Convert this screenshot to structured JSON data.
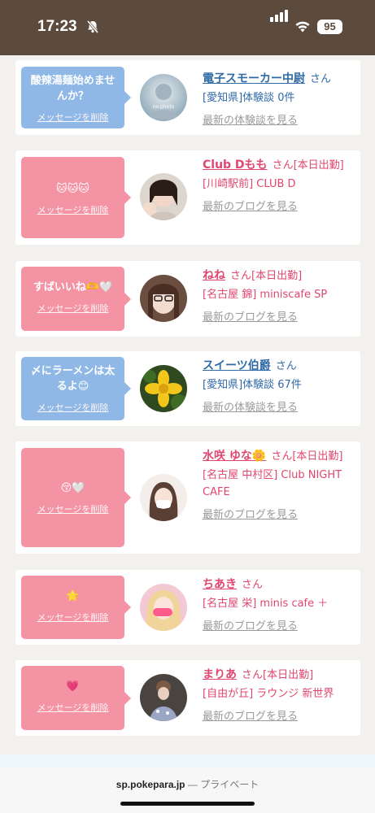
{
  "status": {
    "time": "17:23",
    "battery": "95"
  },
  "browser": {
    "host": "sp.pokepara.jp",
    "separator": "—",
    "mode": "プライベート"
  },
  "items": [
    {
      "color": "blue",
      "message": "酸辣湯麺始めませんか？",
      "delete_label": "メッセージを削除",
      "name": "電子スモーカー中尉",
      "san": "さん",
      "line2": "[愛知県]体験談 0件",
      "shop": "",
      "latest": "最新の体験談を見る",
      "avatar_text": "no photo"
    },
    {
      "color": "pink",
      "message": "🐱🐱🐱",
      "delete_label": "メッセージを削除",
      "name": "Club Dもも",
      "san": "さん[本日出勤]",
      "line2": "",
      "shop": "[川崎駅前] CLUB D",
      "latest": "最新のブログを見る"
    },
    {
      "color": "pink",
      "message": "すばいいね🫶🤍",
      "delete_label": "メッセージを削除",
      "name": "ねね",
      "san": "さん[本日出勤]",
      "line2": "",
      "shop": "[名古屋 錦] miniscafe SP",
      "latest": "最新のブログを見る"
    },
    {
      "color": "blue",
      "message": "〆にラーメンは太るよ😊",
      "delete_label": "メッセージを削除",
      "name": "スイーツ伯爵",
      "san": "さん",
      "line2": "[愛知県]体験談 67件",
      "shop": "",
      "latest": "最新の体験談を見る"
    },
    {
      "color": "pink",
      "message": "😚🤍",
      "delete_label": "メッセージを削除",
      "name": "水咲 ゆな🌼",
      "san": "さん[本日出勤]",
      "line2": "",
      "shop": "[名古屋 中村区] Club NIGHT CAFE",
      "latest": "最新のブログを見る"
    },
    {
      "color": "pink",
      "message": "🌟",
      "delete_label": "メッセージを削除",
      "name": "ちあき",
      "san": "さん",
      "line2": "",
      "shop": "[名古屋 栄] minis cafe ＋",
      "latest": "最新のブログを見る"
    },
    {
      "color": "pink",
      "message": "💗",
      "delete_label": "メッセージを削除",
      "name": "まりあ",
      "san": "さん[本日出勤]",
      "line2": "",
      "shop": "[自由が丘] ラウンジ 新世界",
      "latest": "最新のブログを見る"
    }
  ]
}
